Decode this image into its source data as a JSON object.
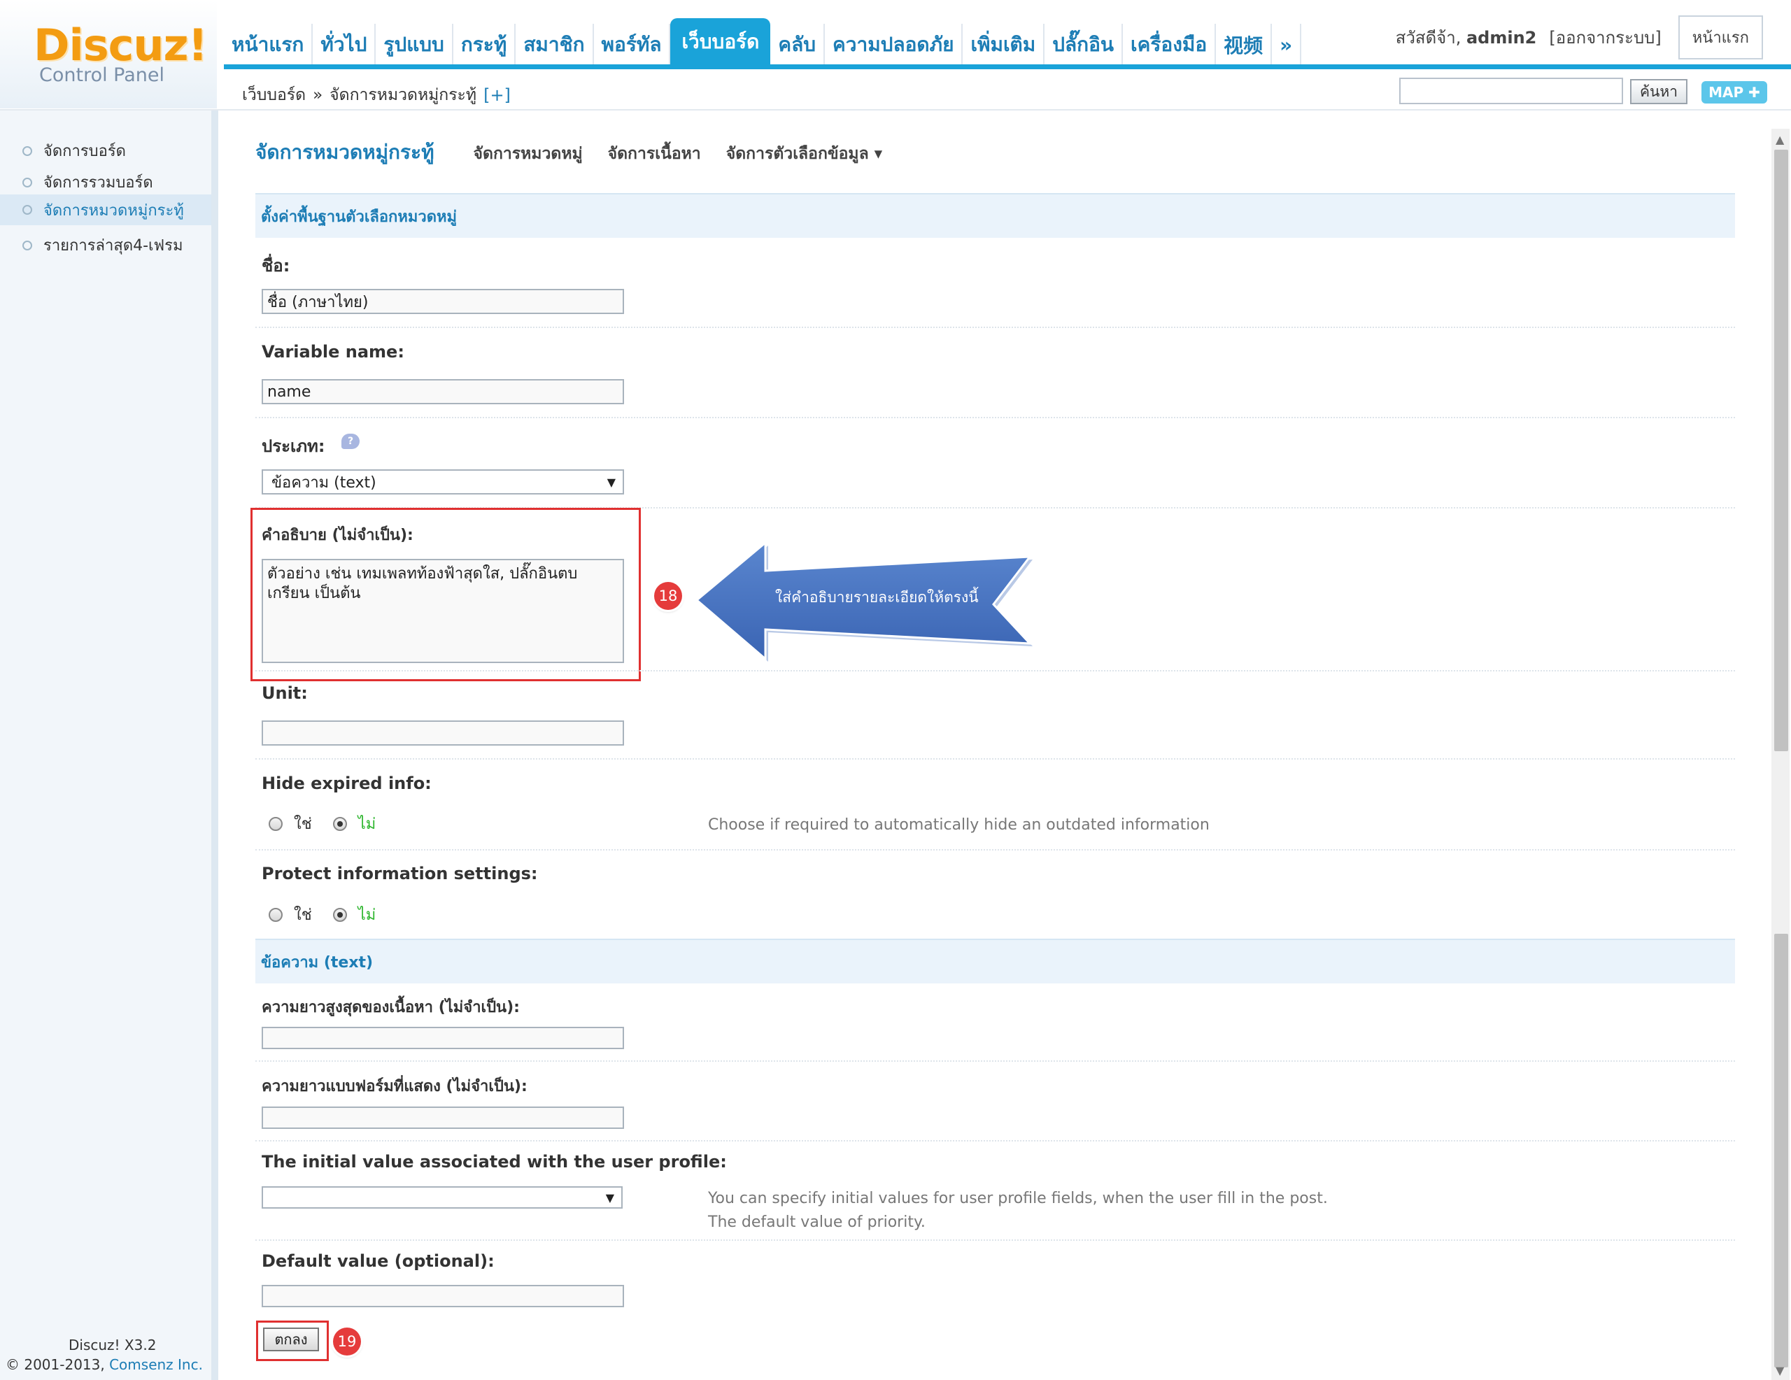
{
  "header": {
    "logo_text": "Discuz!",
    "logo_subtitle": "Control Panel",
    "nav": [
      "หน้าแรก",
      "ทั่วไป",
      "รูปแบบ",
      "กระทู้",
      "สมาชิก",
      "พอร์ทัล",
      "เว็บบอร์ด",
      "คลับ",
      "ความปลอดภัย",
      "เพิ่มเติม",
      "ปลั๊กอิน",
      "เครื่องมือ",
      "视频",
      "»"
    ],
    "active_nav_index": 6,
    "greeting": "สวัสดีจ้า,",
    "username": "admin2",
    "logout": "[ออกจากระบบ]",
    "home_button": "หน้าแรก",
    "breadcrumb": [
      "เว็บบอร์ด",
      "»",
      "จัดการหมวดหมู่กระทู้",
      "[+]"
    ],
    "search_placeholder": "",
    "search_button": "ค้นหา",
    "map_button": "MAP ✚"
  },
  "sidebar": {
    "items": [
      {
        "label": "จัดการบอร์ด",
        "active": false
      },
      {
        "label": "จัดการรวมบอร์ด",
        "active": false
      },
      {
        "label": "จัดการหมวดหมู่กระทู้",
        "active": true
      },
      {
        "label": "รายการล่าสุด4-เฟรม",
        "active": false
      }
    ],
    "footer_line1": "Discuz! X3.2",
    "footer_line2_prefix": "© 2001-2013, ",
    "footer_line2_company": "Comsenz Inc."
  },
  "tabs": {
    "main": "จัดการหมวดหมู่กระทู้",
    "items": [
      "จัดการหมวดหมู่",
      "จัดการเนื้อหา",
      "จัดการตัวเลือกข้อมูล ▾"
    ]
  },
  "form": {
    "section1_title": "ตั้งค่าพื้นฐานตัวเลือกหมวดหมู่",
    "name_label": "ชื่อ:",
    "name_value": "ชื่อ (ภาษาไทย)",
    "varname_label": "Variable name:",
    "varname_value": "name",
    "type_label": "ประเภท:",
    "help_icon": "?",
    "type_value": "ข้อความ (text)",
    "desc_label": "คำอธิบาย (ไม่จำเป็น):",
    "desc_value": "ตัวอย่าง เช่น เทมเพลทท้องฟ้าสุดใส, ปลั๊กอินตบเกรียน เป็นต้น",
    "unit_label": "Unit:",
    "unit_value": "",
    "hide_expired_label": "Hide expired info:",
    "yes": "ใช่",
    "no": "ไม่",
    "hide_expired_hint": "Choose if required to automatically hide an outdated information",
    "protect_label": "Protect information settings:",
    "section2_title": "ข้อความ (text)",
    "maxlen_label": "ความยาวสูงสุดของเนื้อหา (ไม่จำเป็น):",
    "maxlen_value": "",
    "formlen_label": "ความยาวแบบฟอร์มที่แสดง (ไม่จำเป็น):",
    "formlen_value": "",
    "profile_label": "The initial value associated with the user profile:",
    "profile_value": "",
    "profile_hint_1": "You can specify initial values for user profile fields, when the user fill in the post.",
    "profile_hint_2": "The default value of priority.",
    "default_label": "Default value (optional):",
    "default_value": "",
    "submit": "ตกลง"
  },
  "annotations": {
    "badge18": "18",
    "badge19": "19",
    "arrow_text": "ใส่คำอธิบายรายละเอียดให้ตรงนี้"
  }
}
